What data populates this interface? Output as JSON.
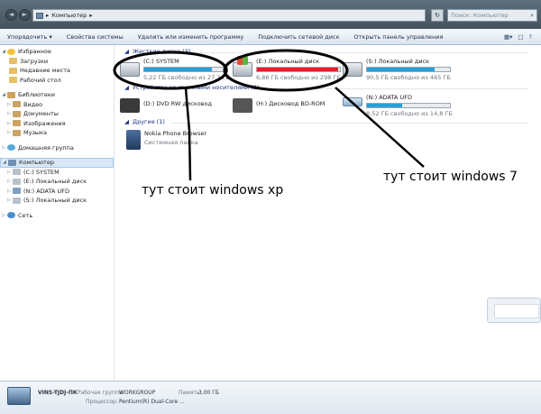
{
  "window": {
    "address_path": "Компьютер",
    "refresh_glyph": "↻",
    "search_placeholder": "Поиск: Компьютер",
    "nav_back": "◄",
    "nav_forward": "►"
  },
  "toolbar": {
    "items": [
      "Упорядочить ▾",
      "Свойства системы",
      "Удалить или изменить программу",
      "Подключить сетевой диск",
      "Открыть панель управления"
    ],
    "view_glyphs": [
      "▦▾",
      "□",
      "?"
    ]
  },
  "sidebar": {
    "favorites": {
      "label": "Избранное",
      "items": [
        "Загрузки",
        "Недавние места",
        "Рабочий стол"
      ]
    },
    "libraries": {
      "label": "Библиотеки",
      "items": [
        "Видео",
        "Документы",
        "Изображения",
        "Музыка"
      ]
    },
    "homegroup": "Домашняя группа",
    "computer": {
      "label": "Компьютер",
      "items": [
        "(C:) SYSTEM",
        "(E:) Локальный диск",
        "(N:) ADATA UFD",
        "(S:) Локальный диск"
      ]
    },
    "network": "Сеть"
  },
  "groups": {
    "hard_drives": "Жесткие диски (3)",
    "removable": "Устройства со съемными носителями (3)",
    "other": "Другие (1)"
  },
  "drives": {
    "c": {
      "name": "(C:) SYSTEM",
      "free": "5,22 ГБ свободно из 27,2 ГБ",
      "used_fraction": 0.81,
      "bar_color": "#26a0da"
    },
    "e": {
      "name": "(E:) Локальный диск",
      "free": "6,86 ГБ свободно из 298 ГБ",
      "used_fraction": 0.98,
      "bar_color": "#da2626"
    },
    "s": {
      "name": "(S:) Локальный диск",
      "free": "90,5 ГБ свободно из 465 ГБ",
      "used_fraction": 0.81,
      "bar_color": "#26a0da"
    },
    "d": {
      "name": "(D:) DVD RW дисковод"
    },
    "h": {
      "name": "(H:) Дисковод BD-ROM"
    },
    "n": {
      "name": "(N:) ADATA UFD",
      "free": "8,52 ГБ свободно из 14,8 ГБ",
      "used_fraction": 0.42,
      "bar_color": "#26a0da"
    },
    "phone": {
      "name": "Nokia Phone Browser",
      "sub": "Системная папка"
    }
  },
  "annotations": {
    "xp": "тут стоит windows xp",
    "seven": "тут стоит windows 7"
  },
  "status": {
    "pc_name": "VINS-TJDJ-ПК",
    "workgroup_label": "Рабочая группа:",
    "workgroup_value": "WORKGROUP",
    "memory_label": "Память:",
    "memory_value": "3,00 ГБ",
    "cpu_label": "Процессор:",
    "cpu_value": "Pentium(R) Dual-Core ..."
  }
}
